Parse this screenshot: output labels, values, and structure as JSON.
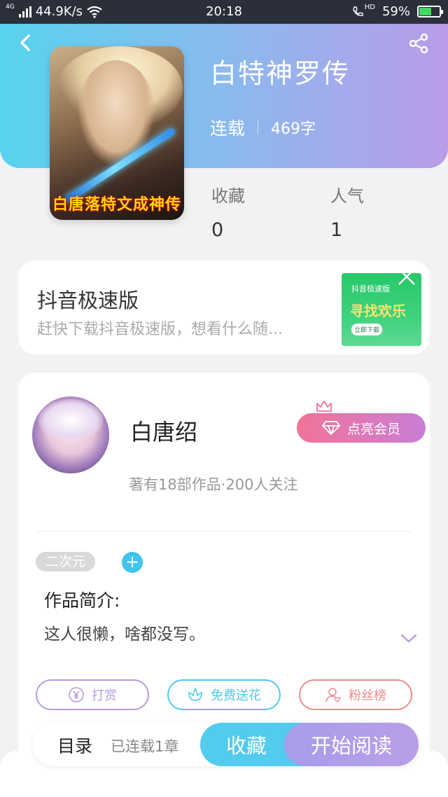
{
  "status_bar": {
    "network": "4G",
    "speed": "44.9K/s",
    "time": "20:18",
    "call_badge": "HD",
    "battery": "59%",
    "battery_level": 0.59
  },
  "book": {
    "title": "白特神罗传",
    "status": "连载",
    "word_count": "469字",
    "cover_text": "白唐落特文成神传",
    "stats": [
      {
        "label": "收藏",
        "value": "0"
      },
      {
        "label": "人气",
        "value": "1"
      }
    ]
  },
  "ad": {
    "title": "抖音极速版",
    "description": "赶快下载抖音极速版，想看什么随...",
    "image_line1": "抖音极速版",
    "image_line2": "寻找欢乐",
    "image_line3": "立即下载"
  },
  "author": {
    "name": "白唐绍",
    "info": "著有18部作品·200人关注",
    "vip_label": "点亮会员"
  },
  "work": {
    "tag": "二次元",
    "add_tag": "+",
    "intro_title": "作品简介:",
    "intro_text": "这人很懒，啥都没写。"
  },
  "actions": [
    {
      "label": "打赏",
      "color": "#b79be0"
    },
    {
      "label": "免费送花",
      "color": "#4ec8ee"
    },
    {
      "label": "粉丝榜",
      "color": "#ef8a8a"
    }
  ],
  "bottom_bar": {
    "toc": "目录",
    "serial": "已连载1章",
    "favorite": "收藏",
    "start_reading": "开始阅读"
  },
  "icons": [
    "back-icon",
    "share-icon",
    "close-icon",
    "crown-icon",
    "diamond-icon",
    "chevron-down-icon",
    "yen-icon",
    "flower-icon",
    "fan-icon",
    "signal-icon",
    "wifi-icon",
    "phone-icon",
    "battery-icon"
  ]
}
